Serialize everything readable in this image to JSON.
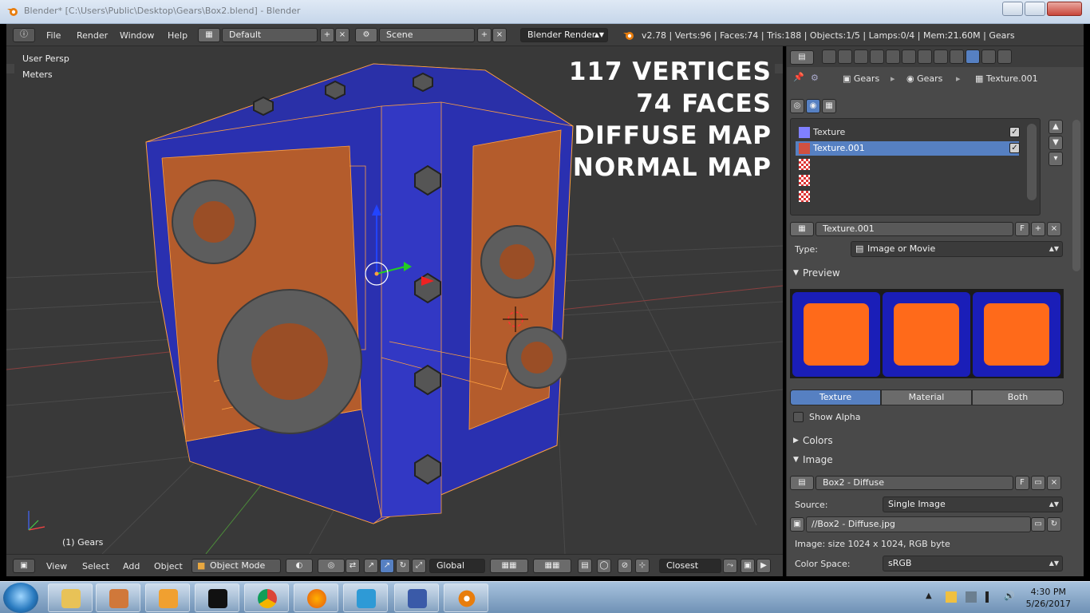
{
  "window": {
    "title": "Blender* [C:\\Users\\Public\\Desktop\\Gears\\Box2.blend] - Blender",
    "app_icon": "blender-icon",
    "colors": {
      "accent": "#5680c2",
      "object_blue": "#2a34b8",
      "panel_orange": "#c8632a",
      "selection_orange": "#ffa040"
    }
  },
  "header": {
    "menus": [
      "File",
      "Render",
      "Window",
      "Help"
    ],
    "layout_value": "Default",
    "scene_value": "Scene",
    "render_engine": "Blender Render",
    "stats": "v2.78 | Verts:96 | Faces:74 | Tris:188 | Objects:1/5 | Lamps:0/4 | Mem:21.60M | Gears"
  },
  "viewport": {
    "view_name": "User Persp",
    "units": "Meters",
    "object_label": "(1) Gears",
    "overlay_lines": [
      "117 VERTICES",
      "74 FACES",
      "DIFFUSE MAP",
      "NORMAL MAP"
    ]
  },
  "footer": {
    "menus": [
      "View",
      "Select",
      "Add",
      "Object"
    ],
    "mode": "Object Mode",
    "orientation": "Global",
    "snap": "Closest"
  },
  "properties": {
    "breadcrumb": [
      "Gears",
      "Gears",
      "Texture.001"
    ],
    "texture_slots": [
      {
        "name": "Texture",
        "checked": true,
        "selected": false
      },
      {
        "name": "Texture.001",
        "checked": true,
        "selected": true
      },
      {
        "name": "",
        "checked": false,
        "selected": false
      },
      {
        "name": "",
        "checked": false,
        "selected": false
      },
      {
        "name": "",
        "checked": false,
        "selected": false
      }
    ],
    "texture_name": "Texture.001",
    "fake_user": "F",
    "type_label": "Type:",
    "type_value": "Image or Movie",
    "preview_header": "Preview",
    "preview_tabs": [
      "Texture",
      "Material",
      "Both"
    ],
    "show_alpha": "Show Alpha",
    "colors_header": "Colors",
    "image_header": "Image",
    "image_name": "Box2 - Diffuse",
    "source_label": "Source:",
    "source_value": "Single Image",
    "filepath": "//Box2 - Diffuse.jpg",
    "image_info": "Image: size 1024 x 1024, RGB byte",
    "color_space_label": "Color Space:",
    "color_space_value": "sRGB"
  },
  "taskbar": {
    "items": [
      "file-explorer-icon",
      "paint-icon",
      "media-player-icon",
      "command-prompt-icon",
      "chrome-icon",
      "firefox-icon",
      "hp-icon",
      "application-icon",
      "blender-icon"
    ],
    "time": "4:30 PM",
    "date": "5/26/2017"
  }
}
